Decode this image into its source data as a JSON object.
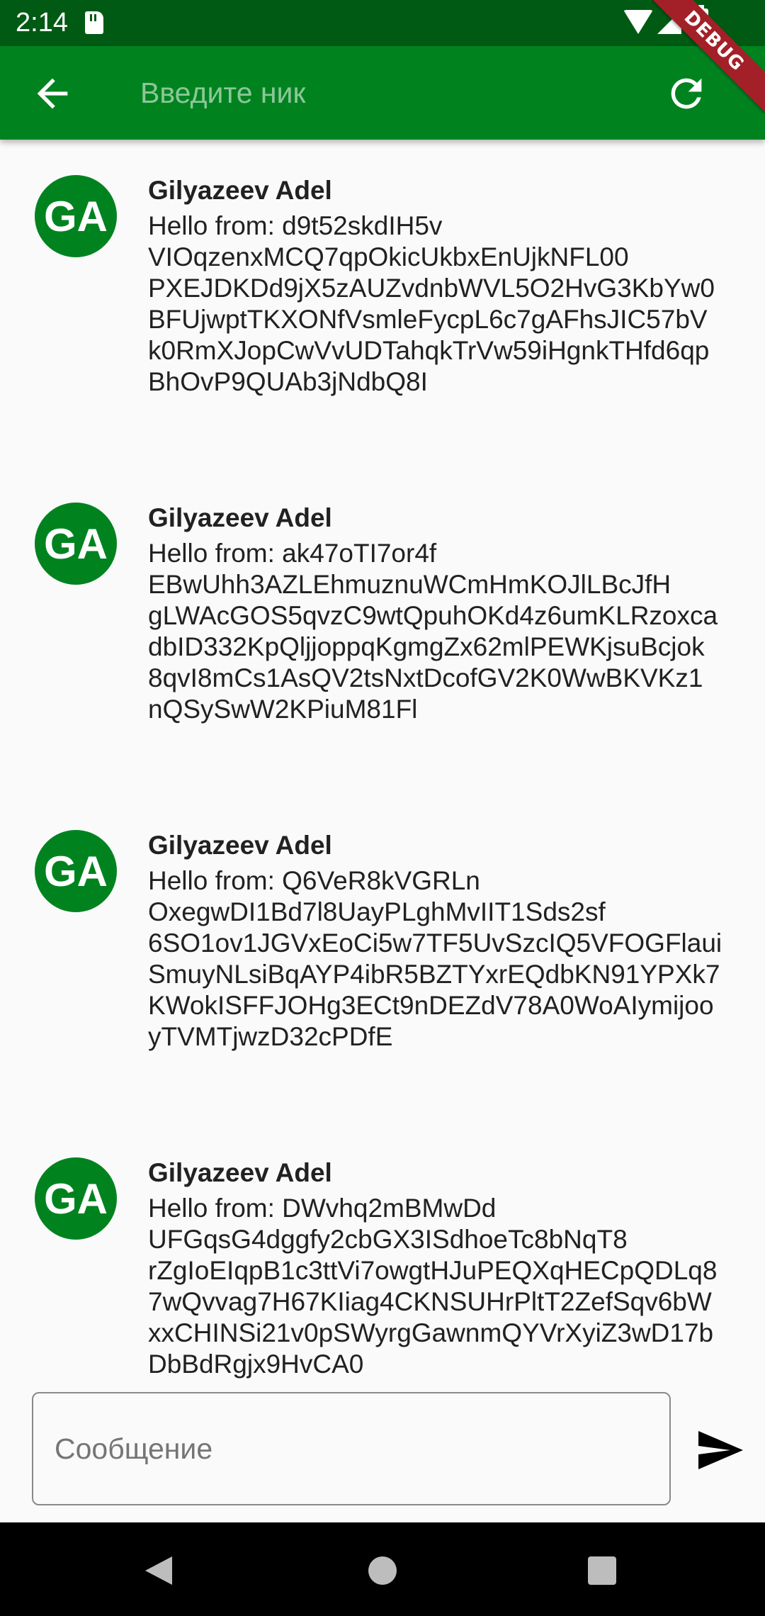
{
  "status_bar": {
    "time": "2:14",
    "icons": [
      "sd-card-icon",
      "wifi-icon",
      "signal-icon",
      "battery-icon"
    ]
  },
  "app_bar": {
    "nick_placeholder": "Введите ник",
    "nick_value": "",
    "back_icon": "arrow-back-icon",
    "refresh_icon": "refresh-icon",
    "debug_banner": "DEBUG",
    "color": "#00831f"
  },
  "messages": [
    {
      "avatar": "GA",
      "author": "Gilyazeev Adel",
      "text": "Hello from: d9t52skdIH5v\nVIOqzenxMCQ7qpOkicUkbxEnUjkNFL00\nPXEJDKDd9jX5zAUZvdnbWVL5O2HvG3KbYw0\nBFUjwptTKXONfVsmleFycpL6c7gAFhsJIC57bV\nk0RmXJopCwVvUDTahqkTrVw59iHgnkTHfd6qp\nBhOvP9QUAb3jNdbQ8I"
    },
    {
      "avatar": "GA",
      "author": "Gilyazeev Adel",
      "text": "Hello from: ak47oTI7or4f\nEBwUhh3AZLEhmuznuWCmHmKOJlLBcJfH\ngLWAcGOS5qvzC9wtQpuhOKd4z6umKLRzoxca\ndbID332KpQljjoppqKgmgZx62mlPEWKjsuBcjok\n8qvI8mCs1AsQV2tsNxtDcofGV2K0WwBKVKz1\nnQSySwW2KPiuM81Fl"
    },
    {
      "avatar": "GA",
      "author": "Gilyazeev Adel",
      "text": "Hello from: Q6VeR8kVGRLn\nOxegwDI1Bd7l8UayPLghMvIIT1Sds2sf\n6SO1ov1JGVxEoCi5w7TF5UvSzcIQ5VFOGFlaui\nSmuyNLsiBqAYP4ibR5BZTYxrEQdbKN91YPXk7\nKWokISFFJOHg3ECt9nDEZdV78A0WoAIymijoo\nyTVMTjwzD32cPDfE"
    },
    {
      "avatar": "GA",
      "author": "Gilyazeev Adel",
      "text": "Hello from: DWvhq2mBMwDd\nUFGqsG4dggfy2cbGX3ISdhoeTc8bNqT8\nrZgIoEIqpB1c3ttVi7owgtHJuPEQXqHECpQDLq8\n7wQvvag7H67KIiag4CKNSUHrPltT2ZefSqv6bW\nxxCHINSi21v0pSWyrgGawnmQYVrXyiZ3wD17b\nDbBdRgjx9HvCA0"
    }
  ],
  "composer": {
    "placeholder": "Сообщение",
    "value": "",
    "send_icon": "send-icon"
  },
  "nav_bar": {
    "icons": [
      "nav-back-icon",
      "nav-home-icon",
      "nav-recents-icon"
    ]
  }
}
